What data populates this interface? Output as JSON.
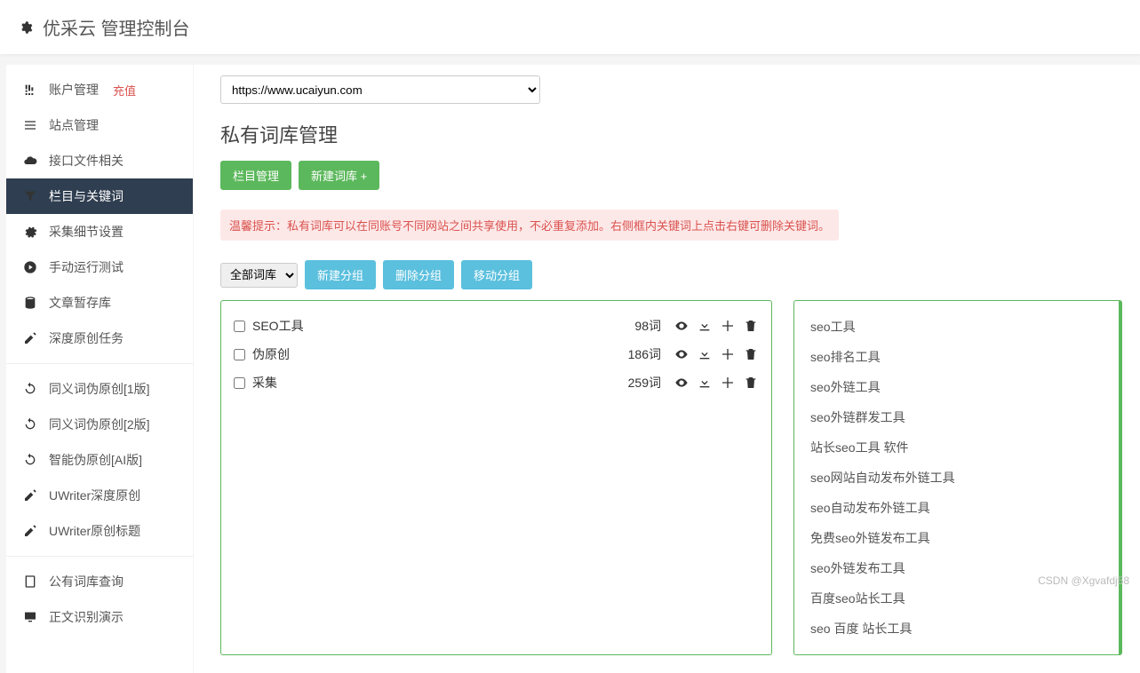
{
  "header": {
    "title": "优采云 管理控制台"
  },
  "sidebar": {
    "items": [
      {
        "label": "账户管理",
        "icon": "bars",
        "badge": "充值"
      },
      {
        "label": "站点管理",
        "icon": "list"
      },
      {
        "label": "接口文件相关",
        "icon": "cloud"
      },
      {
        "label": "栏目与关键词",
        "icon": "filter",
        "active": true
      },
      {
        "label": "采集细节设置",
        "icon": "gears"
      },
      {
        "label": "手动运行测试",
        "icon": "play"
      },
      {
        "label": "文章暂存库",
        "icon": "db"
      },
      {
        "label": "深度原创任务",
        "icon": "edit"
      }
    ],
    "items2": [
      {
        "label": "同义词伪原创[1版]",
        "icon": "refresh"
      },
      {
        "label": "同义词伪原创[2版]",
        "icon": "refresh"
      },
      {
        "label": "智能伪原创[AI版]",
        "icon": "refresh"
      },
      {
        "label": "UWriter深度原创",
        "icon": "edit"
      },
      {
        "label": "UWriter原创标题",
        "icon": "edit"
      }
    ],
    "items3": [
      {
        "label": "公有词库查询",
        "icon": "book"
      },
      {
        "label": "正文识别演示",
        "icon": "monitor"
      }
    ]
  },
  "main": {
    "site_select": "https://www.ucaiyun.com",
    "page_title": "私有词库管理",
    "btn_column": "栏目管理",
    "btn_newlib": "新建词库 +",
    "hint": "温馨提示：私有词库可以在同账号不同网站之间共享使用，不必重复添加。右侧框内关键词上点击右键可删除关键词。",
    "group_select": "全部词库",
    "btn_newgroup": "新建分组",
    "btn_delgroup": "删除分组",
    "btn_movegroup": "移动分组",
    "libs": [
      {
        "name": "SEO工具",
        "count": "98词"
      },
      {
        "name": "伪原创",
        "count": "186词"
      },
      {
        "name": "采集",
        "count": "259词"
      }
    ],
    "keywords": [
      "seo工具",
      "seo排名工具",
      "seo外链工具",
      "seo外链群发工具",
      "站长seo工具 软件",
      "seo网站自动发布外链工具",
      "seo自动发布外链工具",
      "免费seo外链发布工具",
      "seo外链发布工具",
      "百度seo站长工具",
      "seo 百度 站长工具"
    ]
  },
  "watermark": "CSDN @Xgvafdj58"
}
